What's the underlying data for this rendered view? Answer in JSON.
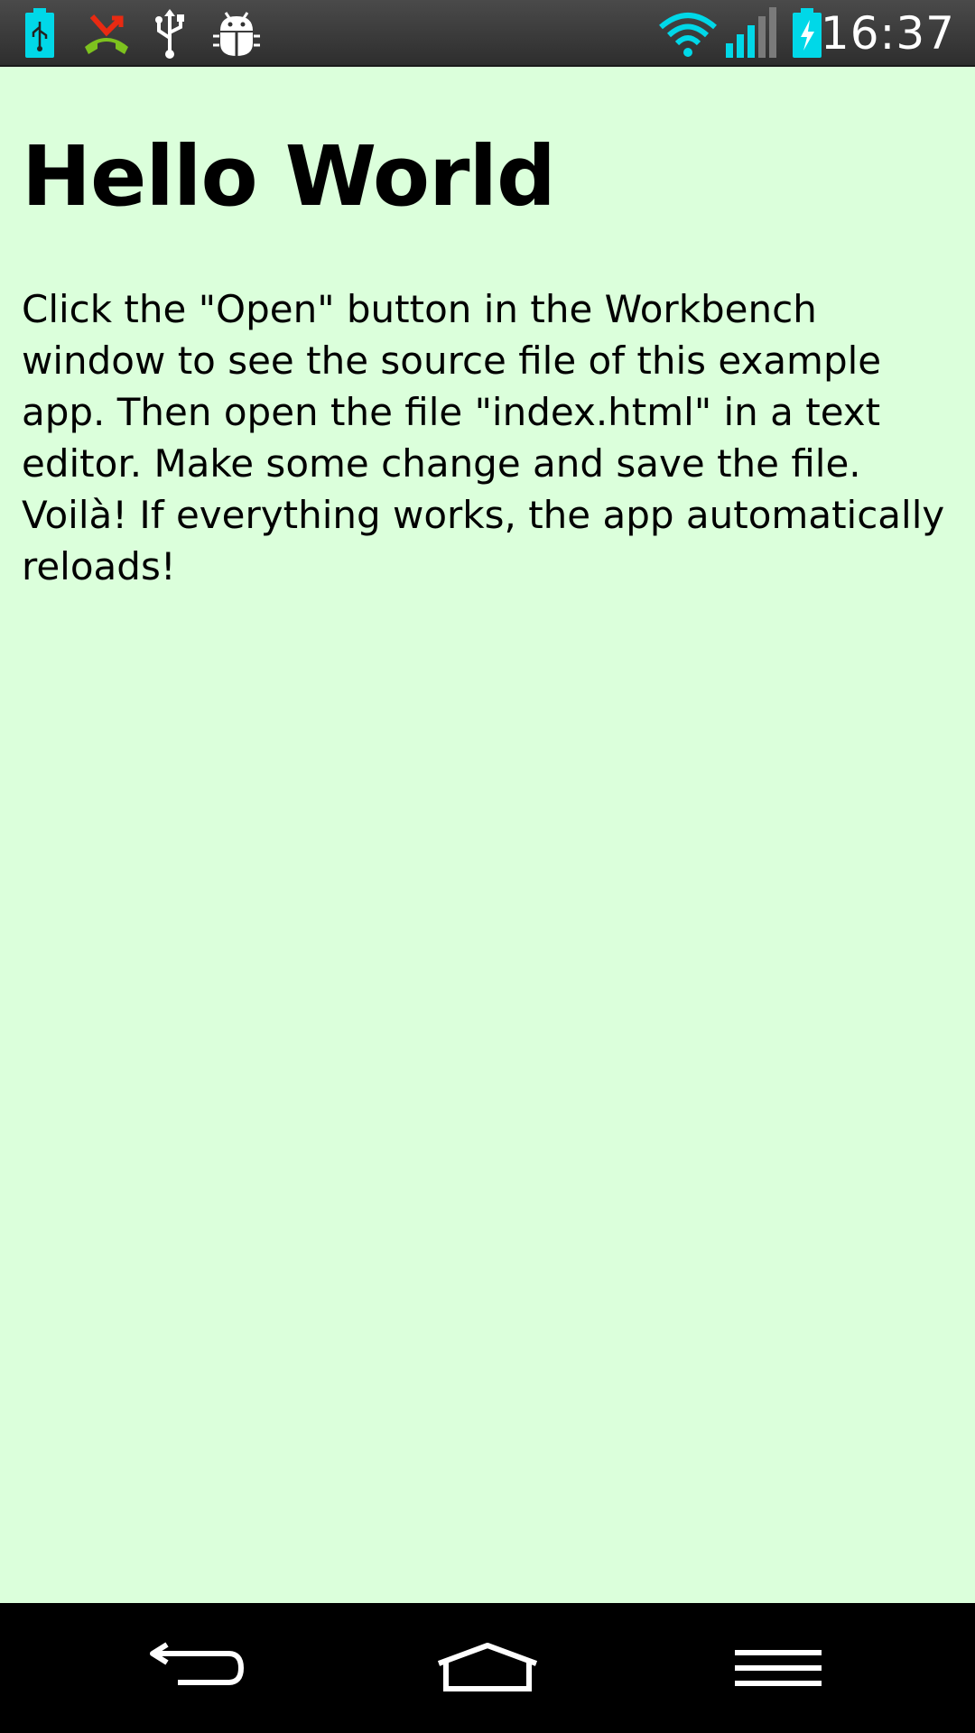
{
  "status_bar": {
    "time": "16:37",
    "left_icons": [
      "usb-battery-icon",
      "missed-call-icon",
      "usb-icon",
      "android-debug-icon"
    ],
    "right_icons": [
      "wifi-icon",
      "signal-icon",
      "battery-charging-icon"
    ],
    "accent_color": "#00d8e8"
  },
  "main": {
    "title": "Hello World",
    "body": "Click the \"Open\" button in the Workbench window to see the source file of this example app. Then open the file \"index.html\" in a text editor. Make some change and save the file. Voilà! If everything works, the app automatically reloads!",
    "background_color": "#dbffdb"
  },
  "nav_bar": {
    "buttons": [
      "back-icon",
      "home-icon",
      "menu-icon"
    ]
  }
}
